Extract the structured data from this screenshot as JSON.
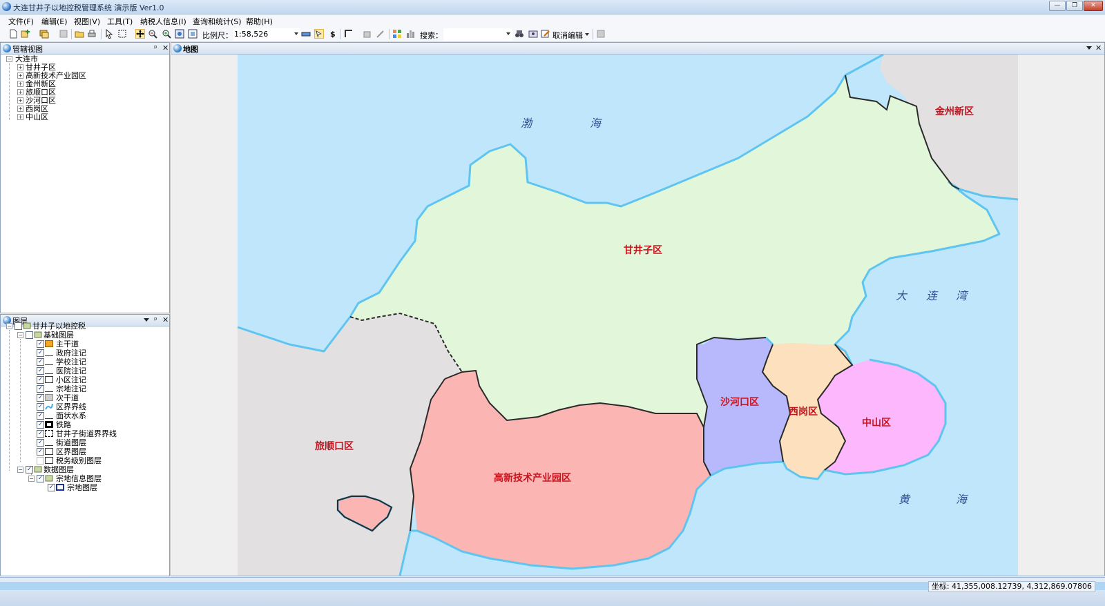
{
  "window": {
    "title": "大连甘井子以地控税管理系统 演示版 Ver1.0",
    "controls": [
      "—",
      "❐",
      "✕"
    ]
  },
  "menu": [
    "文件(F)",
    "编辑(E)",
    "视图(V)",
    "工具(T)",
    "纳税人信息(I)",
    "查询和统计(S)",
    "帮助(H)"
  ],
  "toolbar": {
    "scale_label": "比例尺：",
    "scale_value": "1:58,526",
    "dollar_label": "$",
    "search_label": "搜索：",
    "search_value": "",
    "cancel_edit_label": "取消编辑"
  },
  "admin_panel": {
    "title": "管辖视图",
    "pin": "ᵖ",
    "close": "✕",
    "root": "大连市",
    "children": [
      "甘井子区",
      "高新技术产业园区",
      "金州新区",
      "旅顺口区",
      "沙河口区",
      "西岗区",
      "中山区"
    ]
  },
  "layers_panel": {
    "title": "图层",
    "root": "甘井子以地控税",
    "groups": [
      {
        "name": "基础图层",
        "checked": false,
        "layers": [
          {
            "name": "主干道",
            "checked": true,
            "symbol": "orange-fill"
          },
          {
            "name": "政府注记",
            "checked": true,
            "symbol": "line"
          },
          {
            "name": "学校注记",
            "checked": true,
            "symbol": "line"
          },
          {
            "name": "医院注记",
            "checked": true,
            "symbol": "line"
          },
          {
            "name": "小区注记",
            "checked": true,
            "symbol": "rect"
          },
          {
            "name": "宗地注记",
            "checked": true,
            "symbol": "line"
          },
          {
            "name": "次干道",
            "checked": true,
            "symbol": "grey-fill"
          },
          {
            "name": "区界界线",
            "checked": true,
            "symbol": "blue-line"
          },
          {
            "name": "面状水系",
            "checked": true,
            "symbol": "line"
          },
          {
            "name": "铁路",
            "checked": true,
            "symbol": "black-rect"
          },
          {
            "name": "甘井子街道界界线",
            "checked": true,
            "symbol": "dash-rect"
          },
          {
            "name": "街道图层",
            "checked": true,
            "symbol": "line"
          },
          {
            "name": "区界图层",
            "checked": true,
            "symbol": "rect"
          },
          {
            "name": "税务级别图层",
            "checked": false,
            "symbol": "rect"
          }
        ]
      },
      {
        "name": "数据图层",
        "checked": true,
        "layers": [
          {
            "name": "宗地信息图层",
            "checked": true,
            "symbol": "globe"
          }
        ],
        "sub": {
          "name": "宗地图层",
          "checked": true,
          "symbol": "blue-rect"
        }
      }
    ]
  },
  "map_panel": {
    "title": "地图",
    "districts": {
      "ganjingzi": "甘井子区",
      "jinzhou": "金州新区",
      "lvshun": "旅顺口区",
      "gaoxin": "高新技术产业园区",
      "shahekou": "沙河口区",
      "xigang": "西岗区",
      "zhongshan": "中山区"
    },
    "seas": {
      "bohai_1": "渤",
      "bohai_2": "海",
      "dalian_1": "大",
      "dalian_2": "连",
      "dalian_3": "湾",
      "huanghai_1": "黄",
      "huanghai_2": "海"
    },
    "colors": {
      "sea": "#bfe6fb",
      "coast": "#5fc5f0",
      "ganjingzi": "#e2f6d9",
      "gaoxin": "#fbb6b4",
      "shahekou": "#b8b9fd",
      "xigang": "#fde0be",
      "zhongshan": "#fdb7fd",
      "land_grey": "#e3e0e2",
      "label_red": "#c8141e"
    }
  },
  "status": {
    "coordinates": "坐标: 41,355,008.12739, 4,312,869.07806"
  }
}
